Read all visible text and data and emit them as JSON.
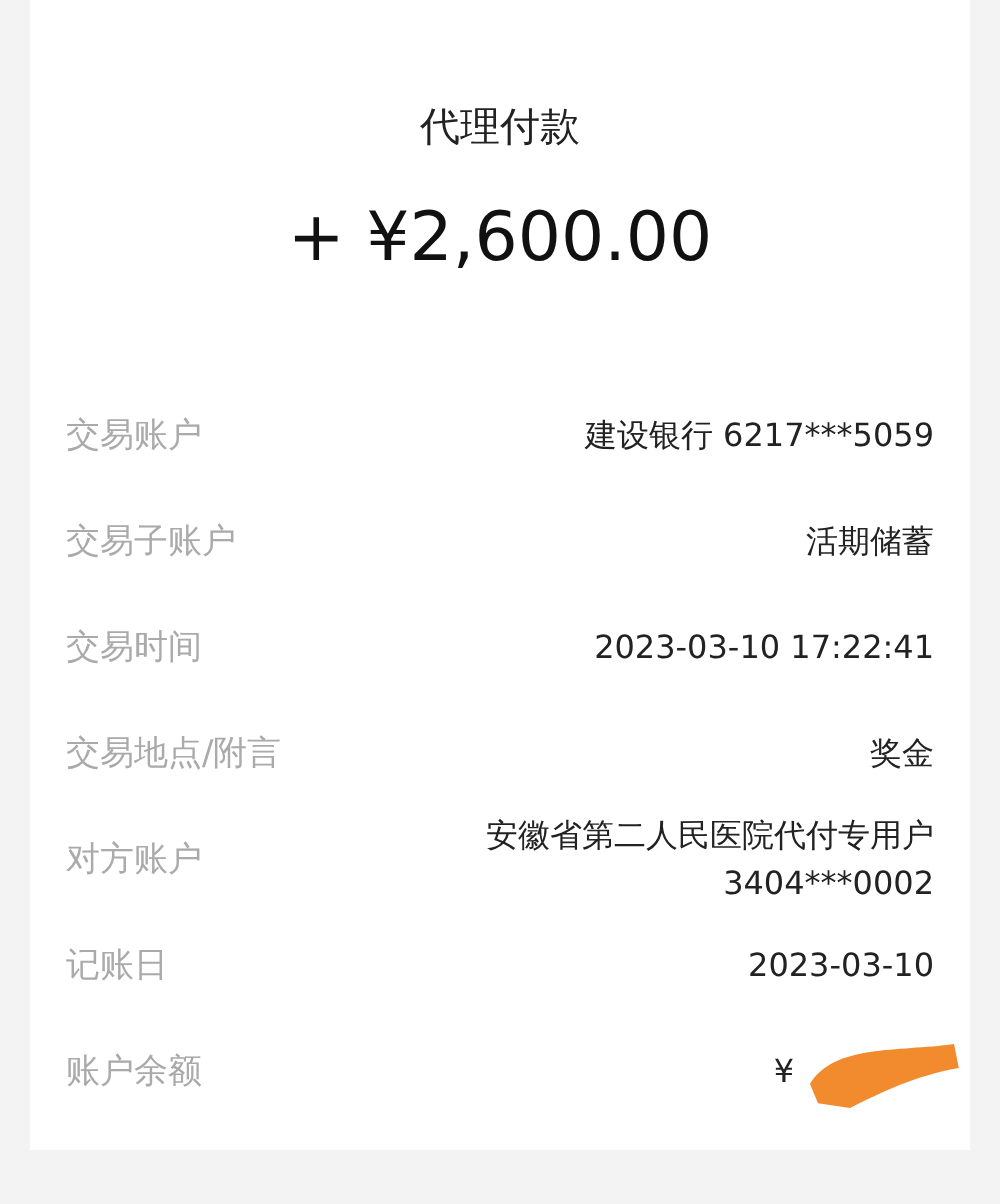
{
  "header": {
    "title": "代理付款",
    "amount": "+ ¥2,600.00"
  },
  "details": [
    {
      "label": "交易账户",
      "value": [
        "建设银行 6217***5059"
      ]
    },
    {
      "label": "交易子账户",
      "value": [
        "活期储蓄"
      ]
    },
    {
      "label": "交易时间",
      "value": [
        "2023-03-10 17:22:41"
      ]
    },
    {
      "label": "交易地点/附言",
      "value": [
        "奖金"
      ]
    },
    {
      "label": "对方账户",
      "value": [
        "安徽省第二人民医院代付专用户",
        "3404***0002"
      ]
    },
    {
      "label": "记账日",
      "value": [
        "2023-03-10"
      ]
    },
    {
      "label": "账户余额",
      "value": [
        "¥"
      ],
      "redacted": true
    }
  ]
}
